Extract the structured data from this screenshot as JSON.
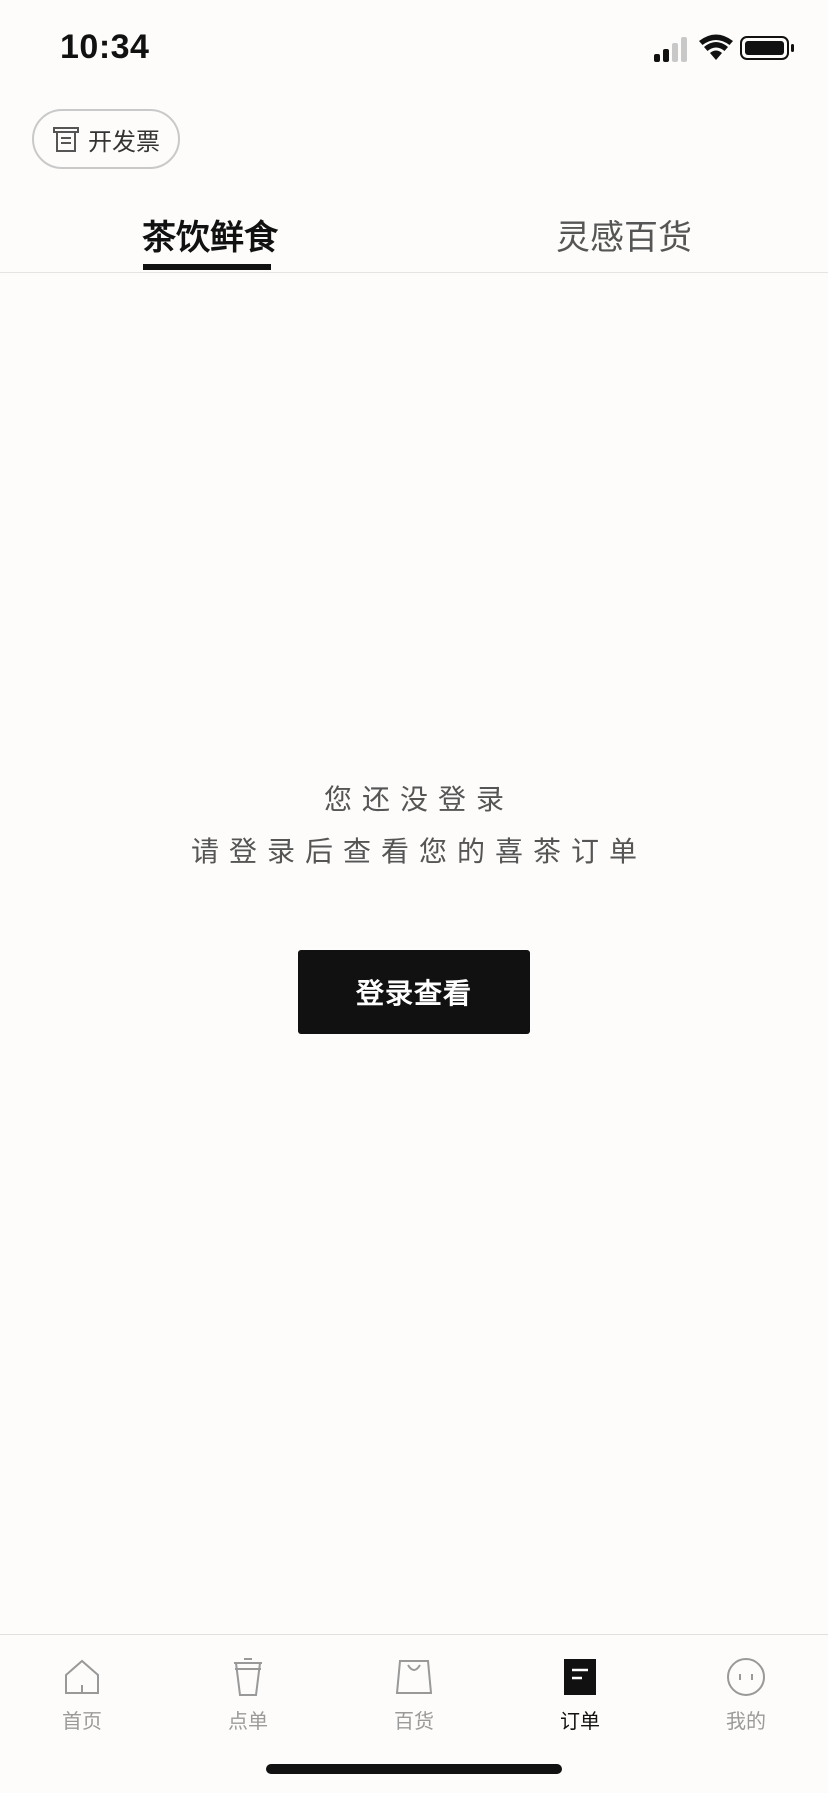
{
  "status_bar": {
    "time": "10:34",
    "icons": [
      "signal-icon",
      "wifi-icon",
      "battery-icon"
    ]
  },
  "invoice": {
    "label": "开发票",
    "icon": "invoice-icon"
  },
  "tabs": [
    {
      "label": "茶饮鲜食",
      "active": true
    },
    {
      "label": "灵感百货",
      "active": false
    }
  ],
  "empty_state": {
    "title": "您还没登录",
    "subtitle": "请登录后查看您的喜茶订单",
    "button_label": "登录查看"
  },
  "bottom_nav": [
    {
      "label": "首页",
      "icon": "home-icon",
      "active": false
    },
    {
      "label": "点单",
      "icon": "cup-icon",
      "active": false
    },
    {
      "label": "百货",
      "icon": "bag-icon",
      "active": false
    },
    {
      "label": "订单",
      "icon": "order-icon",
      "active": true
    },
    {
      "label": "我的",
      "icon": "profile-icon",
      "active": false
    }
  ],
  "colors": {
    "background": "#fdfcfa",
    "primary": "#111111",
    "inactive": "#9a9a9a"
  }
}
